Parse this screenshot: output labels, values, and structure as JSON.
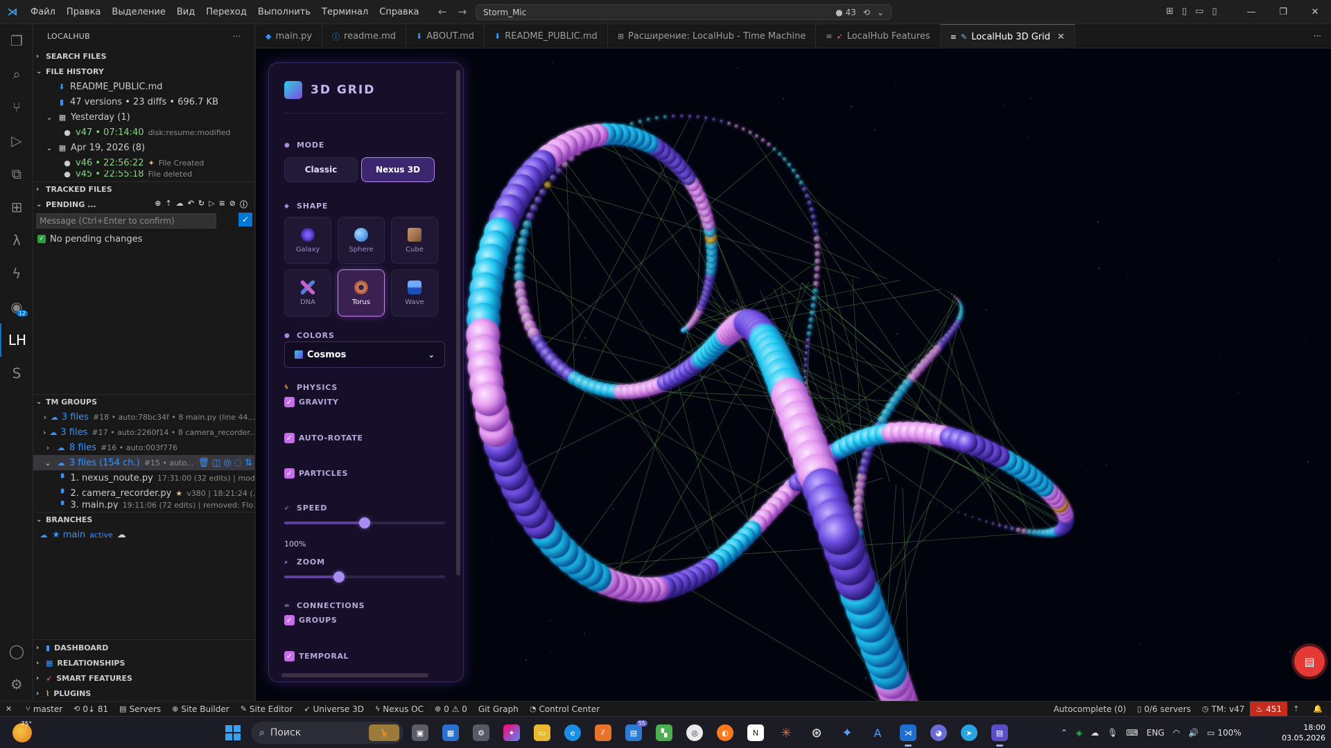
{
  "titlebar": {
    "menu": [
      "Файл",
      "Правка",
      "Выделение",
      "Вид",
      "Переход",
      "Выполнить",
      "Терминал",
      "Справка"
    ],
    "search_text": "Storm_Mic",
    "count": "43"
  },
  "activity": {
    "badge": "12",
    "lh": "LH",
    "s": "S"
  },
  "sidebar": {
    "title": "LOCALHUB",
    "sections": {
      "search_files": "SEARCH FILES",
      "file_history": "FILE HISTORY",
      "tracked_files": "TRACKED FILES",
      "pending": "PENDING ...",
      "tm_groups": "TM GROUPS",
      "branches": "BRANCHES",
      "dashboard": "DASHBOARD",
      "relationships": "RELATIONSHIPS",
      "smart_features": "SMART FEATURES",
      "plugins": "PLUGINS"
    },
    "history": {
      "file": "README_PUBLIC.md",
      "stats": "47 versions • 23 diffs • 696.7 KB",
      "yesterday": "Yesterday (1)",
      "v47": "v47 • 07:14:40",
      "v47_tag": "disk:resume:modified",
      "apr": "Apr 19, 2026 (8)",
      "v46": "v46 • 22:56:22",
      "v46_tag": "File Created",
      "v45": "v45 • 22:55:18",
      "v45_tag": "File deleted"
    },
    "pending": {
      "placeholder": "Message (Ctrl+Enter to confirm)",
      "none": "No pending changes"
    },
    "groups": [
      {
        "files": "3 files",
        "meta": "#18 • auto:78bc34f • 8 main.py (line 44..."
      },
      {
        "files": "3 files",
        "meta": "#17 • auto:2260f14 • 8 camera_recorder..."
      },
      {
        "files": "8 files",
        "meta": "#16 • auto:003f776"
      },
      {
        "files": "3 files (154 ch.)",
        "meta": "#15 • auto..."
      }
    ],
    "group_files": [
      {
        "name": "1. nexus_noute.py",
        "meta": "17:31:00 (32 edits) | mod..."
      },
      {
        "name": "2. camera_recorder.py",
        "meta": "v380 | 18:21:24 (..."
      },
      {
        "name": "3. main.py",
        "meta": "19:11:06 (72 edits) | removed: Flo..."
      }
    ],
    "branch": {
      "name": "★ main",
      "status": "active"
    }
  },
  "tabs": [
    {
      "label": "main.py",
      "icon": "python-icon"
    },
    {
      "label": "readme.md",
      "icon": "info-icon"
    },
    {
      "label": "ABOUT.md",
      "icon": "markdown-icon"
    },
    {
      "label": "README_PUBLIC.md",
      "icon": "markdown-icon"
    },
    {
      "label": "Расширение: LocalHub - Time Machine",
      "icon": "extension-icon"
    },
    {
      "label": "LocalHub Features",
      "icon": "rocket-icon"
    },
    {
      "label": "LocalHub 3D Grid",
      "icon": "grid-icon",
      "active": true
    }
  ],
  "panel": {
    "title": "3D GRID",
    "mode_label": "MODE",
    "modes": [
      "Classic",
      "Nexus 3D"
    ],
    "active_mode": "Nexus 3D",
    "shape_label": "SHAPE",
    "shapes": [
      "Galaxy",
      "Sphere",
      "Cube",
      "DNA",
      "Torus",
      "Wave"
    ],
    "active_shape": "Torus",
    "colors_label": "COLORS",
    "color_scheme": "Cosmos",
    "physics_label": "PHYSICS",
    "physics": {
      "gravity": "GRAVITY",
      "auto_rotate": "AUTO-ROTATE",
      "particles": "PARTICLES"
    },
    "speed_label": "SPEED",
    "speed_value": "100%",
    "speed_fraction": 0.5,
    "zoom_label": "ZOOM",
    "zoom_fraction": 0.34,
    "connections_label": "CONNECTIONS",
    "connections": {
      "groups": "GROUPS",
      "temporal": "TEMPORAL"
    }
  },
  "colors": {
    "accent": "#0078d4",
    "cyan": "#1fc6f0",
    "violet": "#7b55e0",
    "pink": "#e59af0",
    "gold": "#e0a020",
    "link": "#6fae5a"
  },
  "statusbar": {
    "left": [
      "master",
      "0↓ 81",
      "Servers",
      "Site Builder",
      "Site Editor",
      "Universe 3D",
      "Nexus OC",
      "0 ⚠ 0",
      "Git Graph",
      "Control Center"
    ],
    "right": [
      "Autocomplete (0)",
      "0/6 servers",
      "TM: v47"
    ],
    "alert": "451"
  },
  "taskbar": {
    "temp": "75°",
    "search": "Поиск",
    "badge": "55",
    "lang": "ENG",
    "battery": "100%",
    "time": "18:00",
    "date": "03.05.2026"
  }
}
